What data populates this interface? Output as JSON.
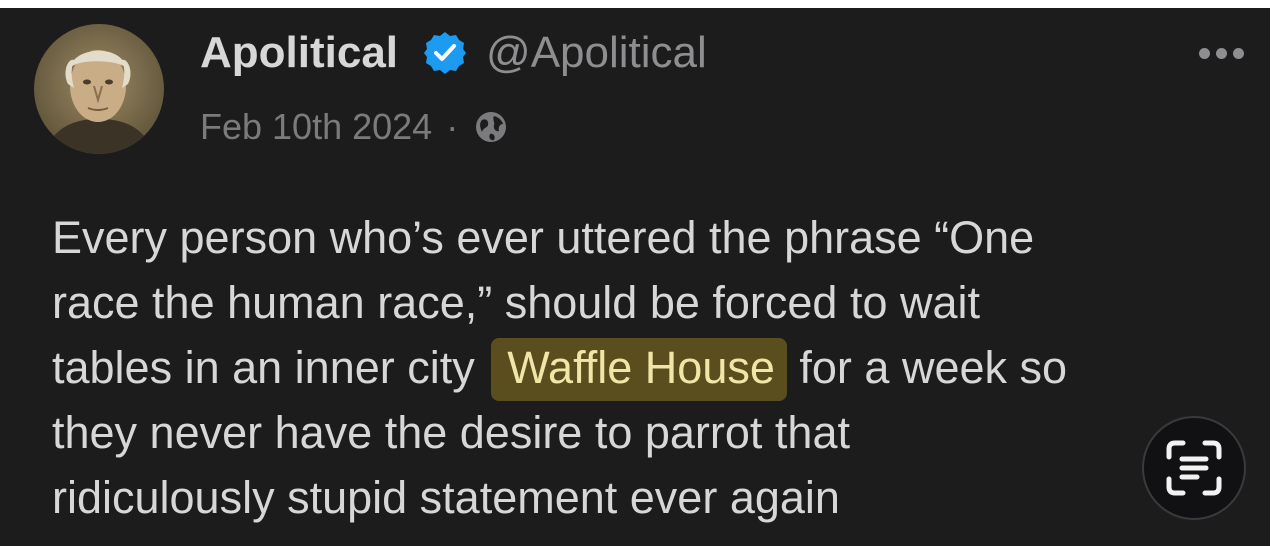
{
  "post": {
    "author": {
      "display_name": "Apolitical",
      "handle": "@Apolitical",
      "verified": true
    },
    "date": "Feb 10th 2024",
    "separator": "·",
    "visibility_icon": "globe-icon",
    "body_lines": [
      {
        "text": "Every person who’s ever uttered the phrase “One"
      },
      {
        "text": "race the human race,” should be forced to wait"
      },
      {
        "before": "tables in an inner city",
        "highlight": "Waffle House",
        "after": "for a week so"
      },
      {
        "text": "they never have the desire to parrot that"
      },
      {
        "text": "ridiculously stupid statement ever again"
      }
    ]
  },
  "controls": {
    "more_icon": "more-horizontal-icon",
    "live_text_icon": "live-text-icon"
  },
  "colors": {
    "background": "#1c1c1d",
    "text": "#d7d7d7",
    "muted": "#8e8e90",
    "verified": "#1d9bf0",
    "highlight_bg": "#5a4e1e"
  }
}
